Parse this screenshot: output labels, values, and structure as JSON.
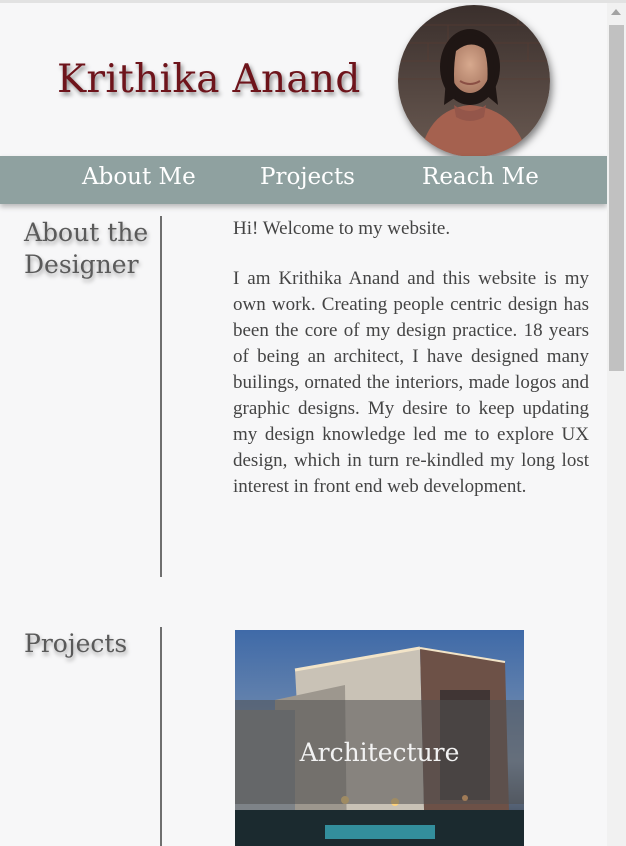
{
  "header": {
    "title": "Krithika Anand"
  },
  "nav": {
    "items": [
      {
        "label": "About Me"
      },
      {
        "label": "Projects"
      },
      {
        "label": "Reach Me"
      }
    ]
  },
  "about": {
    "heading": "About the Designer",
    "greeting": "Hi! Welcome to my website.",
    "body": "I am Krithika Anand and this website is my own work. Creating people centric design has been the core of my design practice. 18 years of being an architect, I have designed many builings, ornated the interiors, made logos and graphic designs. My desire to keep updating my design knowledge led me to explore UX design, which in turn re-kindled my long lost interest in front end web development."
  },
  "projects": {
    "heading": "Projects",
    "cards": [
      {
        "label": "Architecture"
      }
    ]
  },
  "colors": {
    "title": "#6e141b",
    "nav_bg": "#8fa1a0",
    "page_bg": "#f7f7f8"
  },
  "icons": {
    "scroll_up": "triangle-up-icon"
  }
}
